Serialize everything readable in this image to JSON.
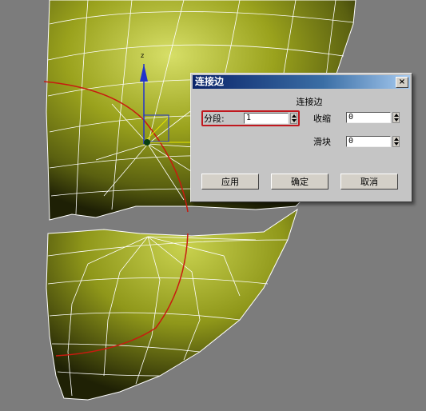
{
  "dialog": {
    "title": "连接边",
    "close_label": "×",
    "group_label": "连接边",
    "segments": {
      "label": "分段:",
      "value": "1"
    },
    "pinch": {
      "label": "收缩",
      "value": "0"
    },
    "slide": {
      "label": "滑块",
      "value": "0"
    },
    "buttons": {
      "apply": "应用",
      "ok": "确定",
      "cancel": "取消"
    }
  },
  "viewport": {
    "axis_label": "z",
    "background_color": "#7c7c7c",
    "mesh_color": "#9aa21d",
    "selection_color": "#c81a10"
  }
}
